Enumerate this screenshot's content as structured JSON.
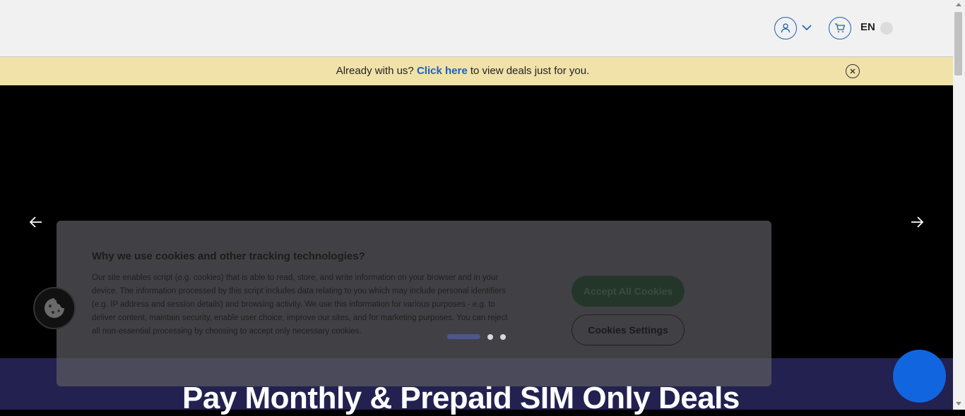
{
  "header": {
    "language": "EN",
    "icons": {
      "account": "user-icon",
      "account_menu": "chevron-down-icon",
      "cart": "cart-icon"
    }
  },
  "banner": {
    "prefix": "Already with us?",
    "link": "Click here",
    "suffix": "to view deals just for you."
  },
  "hero": {
    "title": "Pay Monthly & Prepaid SIM Only Deals",
    "carousel": {
      "slides": 3,
      "active": 1
    }
  },
  "cookie_banner": {
    "title": "Why we use cookies and other tracking technologies?",
    "body": "Our site enables script (e.g. cookies) that is able to read, store, and write information on your browser and in your device. The information processed by this script includes data relating to you which may include personal identifiers (e.g. IP address and session details) and browsing activity. We use this information for various purposes - e.g. to deliver content, maintain security, enable user choice, improve our sites, and for marketing purposes. You can reject all non-essential processing by choosing to accept only necessary cookies.",
    "accept_label": "Accept All Cookies",
    "settings_label": "Cookies Settings"
  },
  "colors": {
    "brand_blue": "#1c5ec8",
    "banner_bg": "#f1e2a9",
    "hero_band": "#22214f",
    "chat_button": "#1166e0"
  }
}
